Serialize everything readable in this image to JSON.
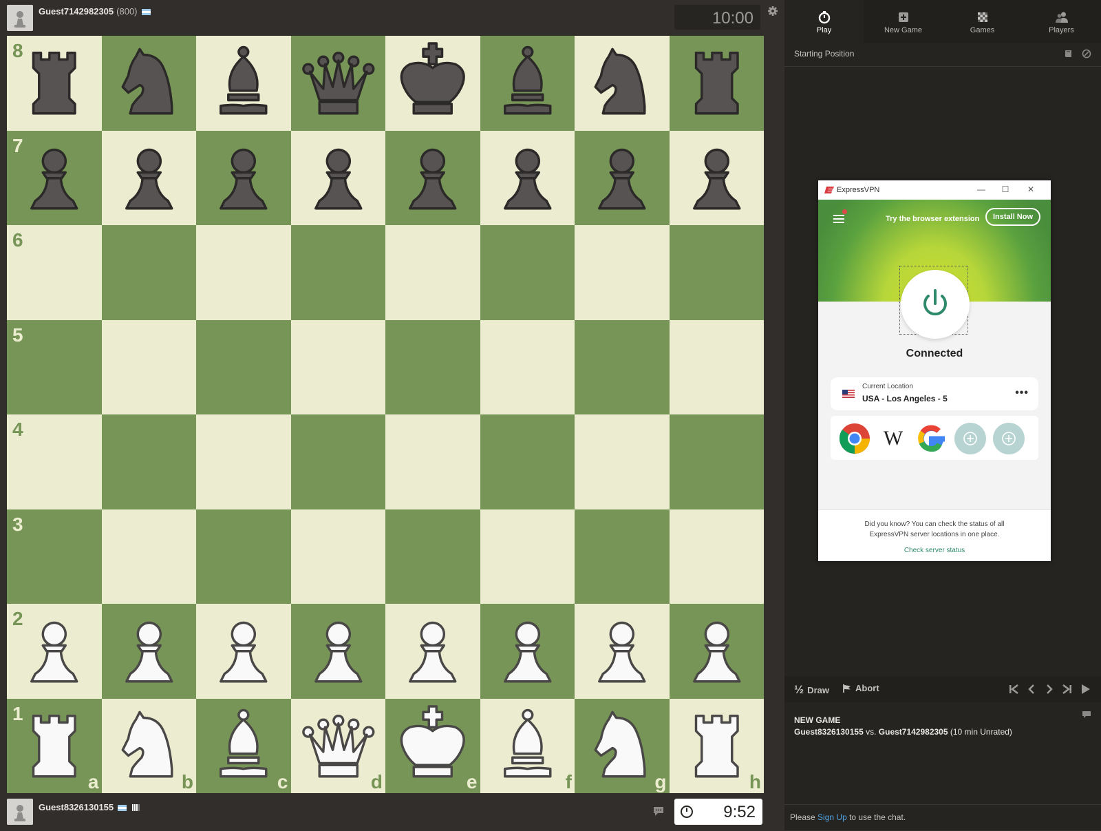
{
  "top_player": {
    "name": "Guest7142982305",
    "rating": "(800)",
    "clock": "10:00"
  },
  "bottom_player": {
    "name": "Guest8326130155",
    "clock": "9:52"
  },
  "board": {
    "ranks": [
      "8",
      "7",
      "6",
      "5",
      "4",
      "3",
      "2",
      "1"
    ],
    "files": [
      "a",
      "b",
      "c",
      "d",
      "e",
      "f",
      "g",
      "h"
    ],
    "position": [
      [
        "bR",
        "bN",
        "bB",
        "bQ",
        "bK",
        "bB",
        "bN",
        "bR"
      ],
      [
        "bP",
        "bP",
        "bP",
        "bP",
        "bP",
        "bP",
        "bP",
        "bP"
      ],
      [
        "",
        "",
        "",
        "",
        "",
        "",
        "",
        ""
      ],
      [
        "",
        "",
        "",
        "",
        "",
        "",
        "",
        ""
      ],
      [
        "",
        "",
        "",
        "",
        "",
        "",
        "",
        ""
      ],
      [
        "",
        "",
        "",
        "",
        "",
        "",
        "",
        ""
      ],
      [
        "wP",
        "wP",
        "wP",
        "wP",
        "wP",
        "wP",
        "wP",
        "wP"
      ],
      [
        "wR",
        "wN",
        "wB",
        "wQ",
        "wK",
        "wB",
        "wN",
        "wR"
      ]
    ],
    "colors": {
      "light": "#ebecd0",
      "dark": "#779556"
    }
  },
  "panel": {
    "tabs": [
      {
        "label": "Play",
        "icon": "stopwatch-icon",
        "active": true
      },
      {
        "label": "New Game",
        "icon": "plus-square-icon"
      },
      {
        "label": "Games",
        "icon": "checkerboard-icon"
      },
      {
        "label": "Players",
        "icon": "players-icon"
      }
    ],
    "subheader": "Starting Position",
    "controls": {
      "draw": "Draw",
      "draw_icon": "½",
      "abort": "Abort"
    },
    "game_info": {
      "heading": "NEW GAME",
      "white": "Guest8326130155",
      "vs": "vs.",
      "black": "Guest7142982305",
      "detail": "(10 min Unrated)"
    },
    "chat": {
      "prefix": "Please",
      "link": "Sign Up",
      "suffix": "to use the chat."
    }
  },
  "vpn": {
    "title": "ExpressVPN",
    "promo": "Try the browser extension",
    "install": "Install Now",
    "status": "Connected",
    "location_label": "Current Location",
    "location": "USA - Los Angeles - 5",
    "more": "•••",
    "shortcuts": [
      "chrome-icon",
      "wikipedia-icon",
      "google-icon",
      "add-shortcut-icon",
      "add-shortcut-icon"
    ],
    "wiki_letter": "W",
    "tip": "Did you know? You can check the status of all ExpressVPN server locations in one place.",
    "link": "Check server status",
    "accent": "#2f8a6b"
  }
}
